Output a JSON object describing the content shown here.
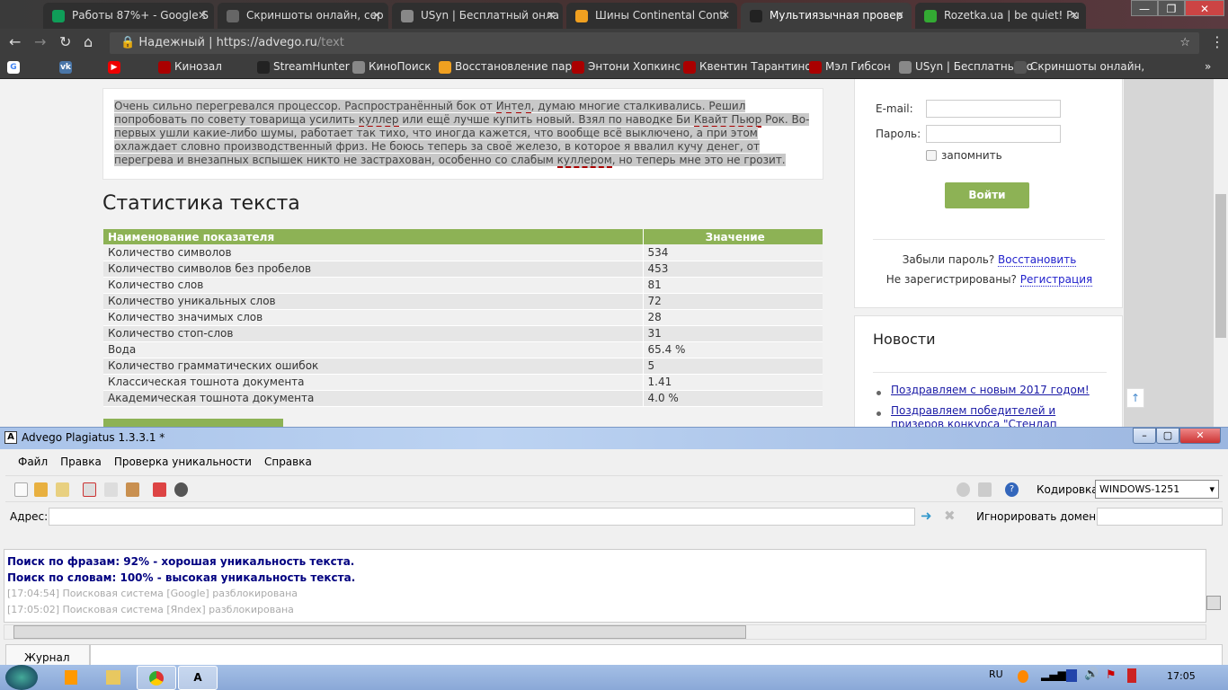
{
  "browser": {
    "tabs": [
      {
        "label": "Работы 87%+ - Google S",
        "color": "#0f9d58"
      },
      {
        "label": "Скриншоты онлайн, сер",
        "color": "#666"
      },
      {
        "label": "USyn | Бесплатный онла",
        "color": "#888"
      },
      {
        "label": "Шины Continental Conti",
        "color": "#f0a020"
      },
      {
        "label": "Мультиязычная провер",
        "color": "#222",
        "active": true
      },
      {
        "label": "Rozetka.ua | be quiet! Pu",
        "color": "#3a3"
      }
    ],
    "secure_label": "Надежный",
    "url_host": "https://advego.ru",
    "url_path": "/text",
    "bookmarks": [
      "Кинозал",
      "StreamHunter",
      "КиноПоиск",
      "Восстановление пар",
      "Энтони Хопкинс",
      "Квентин Тарантино",
      "Мэл Гибсон",
      "USyn | Бесплатный о",
      "Скриншоты онлайн,"
    ],
    "more": "»"
  },
  "page": {
    "text_parts": [
      "Очень сильно перегревался процессор. Распространённый бок от ",
      "Интел",
      ", думаю многие сталкивались. Решил попробовать по совету товарища усилить ",
      "куллер",
      " или ещё лучше купить новый. Взял по наводке Би ",
      "Квайт Пьюр",
      " Рок. Во-первых ушли какие-либо шумы, работает так тихо, что иногда кажется, что вообще всё выключено, а при этом охлаждает словно производственный фриз. Не боюсь теперь за своё железо, в которое я ввалил кучу денег, от перегрева и внезапных вспышек никто не застрахован, особенно со слабым ",
      "куллером",
      ", но теперь мне это не грозит."
    ],
    "stats_title": "Статистика текста",
    "stats_headers": [
      "Наименование показателя",
      "Значение"
    ],
    "stats": [
      [
        "Количество символов",
        "534"
      ],
      [
        "Количество символов без пробелов",
        "453"
      ],
      [
        "Количество слов",
        "81"
      ],
      [
        "Количество уникальных слов",
        "72"
      ],
      [
        "Количество значимых слов",
        "28"
      ],
      [
        "Количество стоп-слов",
        "31"
      ],
      [
        "Вода",
        "65.4 %"
      ],
      [
        "Количество грамматических ошибок",
        "5"
      ],
      [
        "Классическая тошнота документа",
        "1.41"
      ],
      [
        "Академическая тошнота документа",
        "4.0 %"
      ]
    ],
    "login": {
      "email_label": "E-mail:",
      "password_label": "Пароль:",
      "remember": "запомнить",
      "submit": "Войти",
      "forgot": "Забыли пароль?",
      "restore": "Восстановить",
      "not_registered": "Не зарегистрированы?",
      "register": "Регистрация"
    },
    "news": {
      "title": "Новости",
      "items": [
        "Поздравляем с новым 2017 годом!",
        "Поздравляем победителей и призеров конкурса \"Стендап Адвего\"!"
      ]
    },
    "up": "↑"
  },
  "app": {
    "title": "Advego Plagiatus 1.3.3.1 *",
    "menu": [
      "Файл",
      "Правка",
      "Проверка уникальности",
      "Справка"
    ],
    "encoding_label": "Кодировка:",
    "encoding_value": "WINDOWS-1251",
    "address_label": "Адрес:",
    "ignore_label": "Игнорировать домены:",
    "log": [
      {
        "text": "Поиск по фразам: 92% - хорошая уникальность текста.",
        "style": "bold"
      },
      {
        "text": "Поиск по словам: 100% - высокая уникальность текста.",
        "style": "bold"
      },
      {
        "text": "[17:04:54] Поисковая система [Google] разблокирована",
        "style": "gray"
      },
      {
        "text": "[17:05:02] Поисковая система [Яndex] разблокирована",
        "style": "gray"
      }
    ],
    "journal_tab": "Журнал"
  },
  "taskbar": {
    "lang": "RU",
    "time": "17:05"
  }
}
